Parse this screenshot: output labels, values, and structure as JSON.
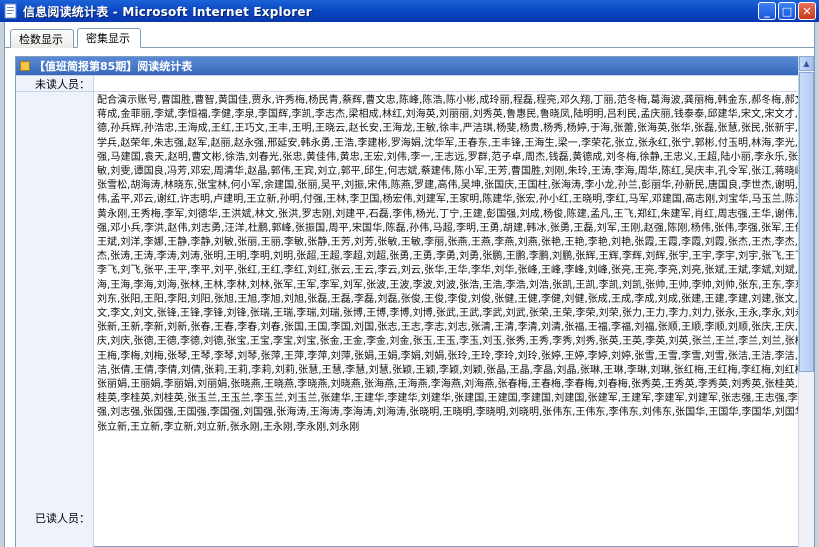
{
  "window": {
    "title": "信息阅读统计表 - Microsoft Internet Explorer",
    "app_icon": "ie-document-icon",
    "controls": {
      "minimize": "_",
      "maximize": "□",
      "close": "✕"
    }
  },
  "tabs": [
    {
      "label": "检数显示",
      "active": false
    },
    {
      "label": "密集显示",
      "active": true
    }
  ],
  "panel": {
    "header": "【值班简报第85期】阅读统计表",
    "unread_label": "未读人员：",
    "unread_value": "",
    "read_label": "已读人员：",
    "read_names": "配合演示账号,曹国胜,曹智,黄国佳,贾永,许秀梅,杨民青,蔡辉,曹文忠,陈峰,陈浩,陈小彬,成玲丽,程磊,程亮,邓久翔,丁丽,范冬梅,葛海波,龚丽梅,韩金东,郝冬梅,郝文,蒋成,金菲丽,李斌,李恒福,李健,李泉,李国辉,李凯,李志杰,梁相成,林红,刘海英,刘丽丽,刘秀英,鲁惠民,鲁晓凤,陆明明,吕利民,孟庆丽,钱泰泰,邱建华,宋文,宋文才,孙德,孙兵辉,孙浩忠,王海成,王红,王巧文,王丰,王明,王晓云,赵长安,王海龙,王敏,徐丰,严洁琪,杨斐,杨贵,杨秀,杨婷,于海,张蕾,张海英,张华,张磊,张慧,张民,张新宇,赵学兵,赵荣年,朱志强,赵军,赵丽,赵永强,邢延安,韩永勇,王浩,李建彬,罗海娟,沈华军,王春东,王丰锋,王海生,梁一,李荣花,张立,张永红,张宁,郭彬,付玉明,林海,李光,王强,马建国,袁天,赵明,曹文彬,徐浩,刘春光,张忠,黄佳伟,黄忠,王宏,刘伟,李一,王志远,罗群,范子卓,周杰,钱磊,黄德成,刘冬梅,徐静,王忠义,王超,陆小丽,李永乐,张淑敏,刘雯,谭国良,冯芳,邓宏,周清华,赵晶,郭伟,王宾,刘立,郭平,邱生,何志斌,蔡建伟,陈小军,王芳,曹国胜,刘刚,朱玲,王涛,李海,周华,陈红,吴庆丰,孔令军,张江,蒋晓峰,张雪松,胡海涛,林晓东,张宝林,何小军,余建国,张丽,吴平,刘振,宋伟,陈燕,罗建,高伟,吴坤,张国庆,王国柱,张海涛,李小龙,孙兰,彭丽华,孙新民,唐国良,李世杰,谢明,周伟,孟平,邓云,谢红,许志明,卢建明,王立新,孙明,付强,王林,李卫国,杨宏伟,刘建军,王家明,陈建华,张宏,孙小红,王晓明,李红,马军,邓建国,高志刚,刘宝华,马玉兰,陈涛,黄永刚,王秀梅,李军,刘德华,王洪斌,林文,张洪,罗志刚,刘建平,石磊,李伟,杨光,丁宁,王建,彭国强,刘成,杨俊,陈建,孟凡,王飞,郑红,朱建军,肖红,周志强,王华,谢伟,吴强,邓小兵,李洪,赵伟,刘志勇,汪洋,杜鹏,郭峰,张振国,周平,宋国华,陈磊,孙伟,马超,李明,王勇,胡建,韩冰,张勇,王磊,刘军,王刚,赵强,陈刚,杨伟,张伟,李强,张军,王伟,王斌,刘洋,李娜,王静,李静,刘敏,张丽,王丽,李敏,张静,王芳,刘芳,张敏,王敏,李丽,张燕,王燕,李燕,刘燕,张艳,王艳,李艳,刘艳,张霞,王霞,李霞,刘霞,张杰,王杰,李杰,刘杰,张涛,王涛,李涛,刘涛,张明,王明,李明,刘明,张超,王超,李超,刘超,张勇,王勇,李勇,刘勇,张鹏,王鹏,李鹏,刘鹏,张辉,王辉,李辉,刘辉,张宇,王宇,李宇,刘宇,张飞,王飞,李飞,刘飞,张平,王平,李平,刘平,张红,王红,李红,刘红,张云,王云,李云,刘云,张华,王华,李华,刘华,张峰,王峰,李峰,刘峰,张亮,王亮,李亮,刘亮,张斌,王斌,李斌,刘斌,张海,王海,李海,刘海,张林,王林,李林,刘林,张军,王军,李军,刘军,张波,王波,李波,刘波,张浩,王浩,李浩,刘浩,张凯,王凯,李凯,刘凯,张帅,王帅,李帅,刘帅,张东,王东,李东,刘东,张阳,王阳,李阳,刘阳,张旭,王旭,李旭,刘旭,张磊,王磊,李磊,刘磊,张俊,王俊,李俊,刘俊,张健,王健,李健,刘健,张成,王成,李成,刘成,张建,王建,李建,刘建,张文,王文,李文,刘文,张锋,王锋,李锋,刘锋,张瑞,王瑞,李瑞,刘瑞,张博,王博,李博,刘博,张武,王武,李武,刘武,张荣,王荣,李荣,刘荣,张力,王力,李力,刘力,张永,王永,李永,刘永,张新,王新,李新,刘新,张春,王春,李春,刘春,张国,王国,李国,刘国,张志,王志,李志,刘志,张清,王清,李清,刘清,张福,王福,李福,刘福,张顺,王顺,李顺,刘顺,张庆,王庆,李庆,刘庆,张德,王德,李德,刘德,张宝,王宝,李宝,刘宝,张金,王金,李金,刘金,张玉,王玉,李玉,刘玉,张秀,王秀,李秀,刘秀,张英,王英,李英,刘英,张兰,王兰,李兰,刘兰,张梅,王梅,李梅,刘梅,张琴,王琴,李琴,刘琴,张萍,王萍,李萍,刘萍,张娟,王娟,李娟,刘娟,张玲,王玲,李玲,刘玲,张婷,王婷,李婷,刘婷,张雪,王雪,李雪,刘雪,张洁,王洁,李洁,刘洁,张倩,王倩,李倩,刘倩,张莉,王莉,李莉,刘莉,张慧,王慧,李慧,刘慧,张颖,王颖,李颖,刘颖,张晶,王晶,李晶,刘晶,张琳,王琳,李琳,刘琳,张红梅,王红梅,李红梅,刘红梅,张丽娟,王丽娟,李丽娟,刘丽娟,张晓燕,王晓燕,李晓燕,刘晓燕,张海燕,王海燕,李海燕,刘海燕,张春梅,王春梅,李春梅,刘春梅,张秀英,王秀英,李秀英,刘秀英,张桂英,王桂英,李桂英,刘桂英,张玉兰,王玉兰,李玉兰,刘玉兰,张建华,王建华,李建华,刘建华,张建国,王建国,李建国,刘建国,张建军,王建军,李建军,刘建军,张志强,王志强,李志强,刘志强,张国强,王国强,李国强,刘国强,张海涛,王海涛,李海涛,刘海涛,张晓明,王晓明,李晓明,刘晓明,张伟东,王伟东,李伟东,刘伟东,张国华,王国华,李国华,刘国华,张立新,王立新,李立新,刘立新,张永刚,王永刚,李永刚,刘永刚"
  },
  "scrollbar": {
    "up_icon": "▲"
  }
}
